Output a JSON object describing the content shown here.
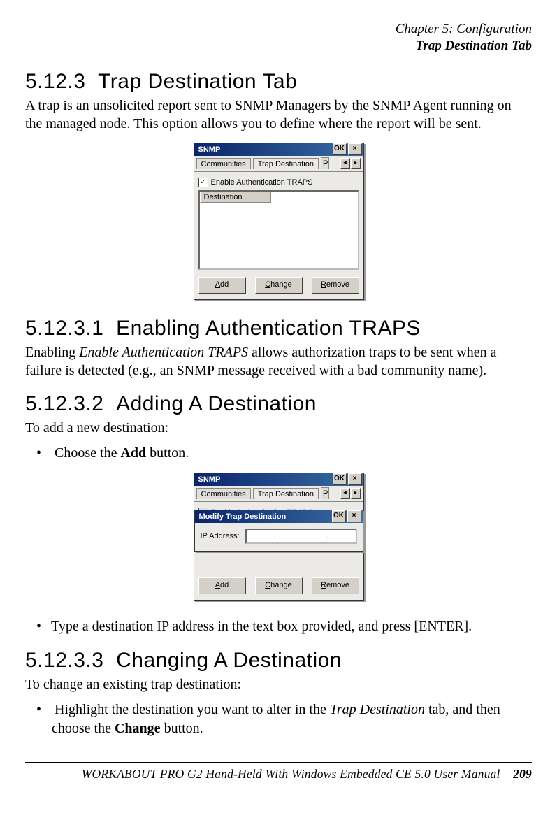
{
  "header": {
    "chapter": "Chapter 5: Configuration",
    "section_name": "Trap Destination Tab"
  },
  "s1": {
    "num": "5.12.3",
    "title": "Trap Destination Tab",
    "body": "A trap is an unsolicited report sent to SNMP Managers by the SNMP Agent running on the managed node. This option allows you to define where the report will be sent."
  },
  "win1": {
    "title": "SNMP",
    "ok": "OK",
    "close": "×",
    "tab_communities": "Communities",
    "tab_trap": "Trap Destination",
    "tab_partial": "P",
    "checkbox_label": "Enable Authentication TRAPS",
    "col_head": "Destination",
    "btn_add_u": "A",
    "btn_add_rest": "dd",
    "btn_change_u": "C",
    "btn_change_rest": "hange",
    "btn_remove_u": "R",
    "btn_remove_rest": "emove"
  },
  "s2": {
    "num": "5.12.3.1",
    "title": "Enabling Authentication TRAPS",
    "body_pre": "Enabling ",
    "body_em": "Enable Authentication TRAPS ",
    "body_post": "allows authorization traps to be sent when a failure is detected (e.g., an SNMP message received with a bad community name)."
  },
  "s3": {
    "num": "5.12.3.2",
    "title": "Adding A Destination",
    "body": "To add a new destination:",
    "bullet1_pre": "Choose the ",
    "bullet1_bold": "Add",
    "bullet1_post": " button.",
    "bullet2": "Type a destination IP address in the text box provided, and press [ENTER]."
  },
  "win2": {
    "modal_title": "Modify Trap Destination",
    "ip_label": "IP Address:",
    "dot": "."
  },
  "s4": {
    "num": "5.12.3.3",
    "title": "Changing A Destination",
    "body": "To change an existing trap destination:",
    "bullet1_pre": "Highlight the destination you want to alter in the ",
    "bullet1_em": "Trap Destination",
    "bullet1_mid": " tab, and then choose the ",
    "bullet1_bold": "Change",
    "bullet1_post": " button."
  },
  "footer": {
    "text": "WORKABOUT PRO G2 Hand-Held With Windows Embedded CE 5.0 User Manual",
    "page": "209"
  }
}
